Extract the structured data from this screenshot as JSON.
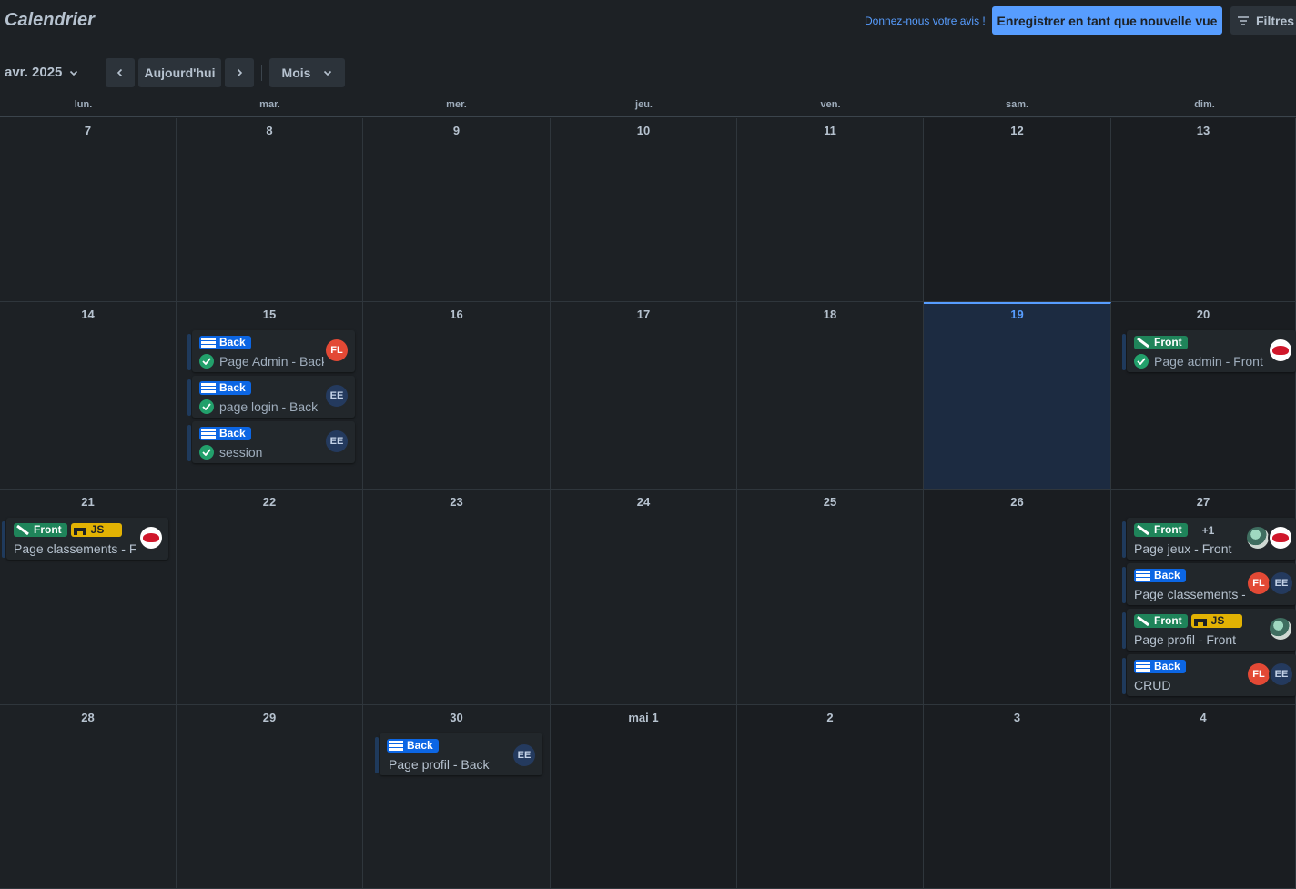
{
  "header": {
    "title": "Calendrier",
    "feedback_link": "Donnez-nous votre avis !",
    "save_view_label": "Enregistrer en tant que nouvelle vue",
    "filters_label": "Filtres"
  },
  "toolbar": {
    "month_label": "avr. 2025",
    "today_label": "Aujourd'hui",
    "view_label": "Mois"
  },
  "weekdays": [
    "lun.",
    "mar.",
    "mer.",
    "jeu.",
    "ven.",
    "sam.",
    "dim."
  ],
  "weeks": [
    [
      "7",
      "8",
      "9",
      "10",
      "11",
      "12",
      "13"
    ],
    [
      "14",
      "15",
      "16",
      "17",
      "18",
      "19",
      "20"
    ],
    [
      "21",
      "22",
      "23",
      "24",
      "25",
      "26",
      "27"
    ],
    [
      "28",
      "29",
      "30",
      "mai 1",
      "2",
      "3",
      "4"
    ]
  ],
  "today": "19",
  "label_names": {
    "back": "Back",
    "front": "Front",
    "js": "JS"
  },
  "cards": [
    {
      "title": "Page Admin - Back",
      "done": true,
      "labels": [
        "Back"
      ],
      "members": [
        "FL"
      ]
    },
    {
      "title": "page login - Back",
      "done": true,
      "labels": [
        "Back"
      ],
      "members": [
        "EE"
      ]
    },
    {
      "title": "session",
      "done": true,
      "labels": [
        "Back"
      ],
      "members": [
        "EE"
      ]
    },
    {
      "title": "Page admin - Front",
      "done": true,
      "labels": [
        "Front"
      ],
      "members": [
        "logo"
      ]
    },
    {
      "title": "Page classements - Fr",
      "done": false,
      "labels": [
        "Front",
        "JS"
      ],
      "members": [
        "logo"
      ]
    },
    {
      "title": "Page jeux - Front",
      "done": false,
      "labels": [
        "Front"
      ],
      "extra_labels": "+1",
      "members": [
        "pic",
        "logo"
      ]
    },
    {
      "title": "Page classements -",
      "done": false,
      "labels": [
        "Back"
      ],
      "members": [
        "FL",
        "EE"
      ]
    },
    {
      "title": "Page profil - Front",
      "done": false,
      "labels": [
        "Front",
        "JS"
      ],
      "members": [
        "pic"
      ]
    },
    {
      "title": "CRUD",
      "done": false,
      "labels": [
        "Back"
      ],
      "members": [
        "FL",
        "EE"
      ]
    },
    {
      "title": "Page profil - Back",
      "done": false,
      "labels": [
        "Back"
      ],
      "members": [
        "EE"
      ]
    }
  ],
  "colors": {
    "background": "#1d2125",
    "accent": "#579dff",
    "label_back": "#0c66e4",
    "label_front": "#1f845a",
    "label_js": "#e2b203",
    "done_check": "#22a06b"
  }
}
